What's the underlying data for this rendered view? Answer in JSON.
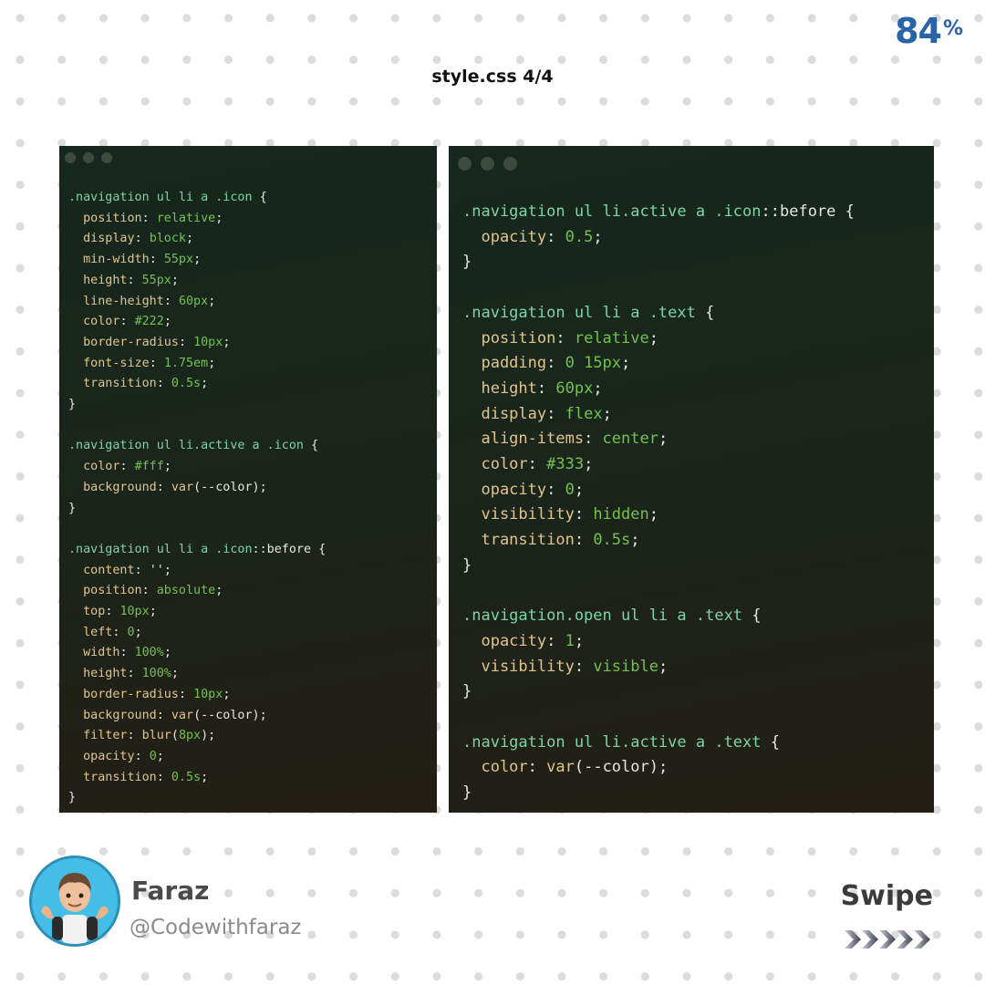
{
  "badge": {
    "number": "84",
    "symbol": "%"
  },
  "file_title": "style.css 4/4",
  "left_window": {
    "lines": [
      [
        [
          ".navigation ul li a .icon",
          "sel"
        ],
        [
          " {",
          "pn"
        ]
      ],
      [
        [
          "  position",
          "prop"
        ],
        [
          ": ",
          "pn"
        ],
        [
          "relative",
          "val"
        ],
        [
          ";",
          "pn"
        ]
      ],
      [
        [
          "  display",
          "prop"
        ],
        [
          ": ",
          "pn"
        ],
        [
          "block",
          "val"
        ],
        [
          ";",
          "pn"
        ]
      ],
      [
        [
          "  min-width",
          "prop"
        ],
        [
          ": ",
          "pn"
        ],
        [
          "55px",
          "val"
        ],
        [
          ";",
          "pn"
        ]
      ],
      [
        [
          "  height",
          "prop"
        ],
        [
          ": ",
          "pn"
        ],
        [
          "55px",
          "val"
        ],
        [
          ";",
          "pn"
        ]
      ],
      [
        [
          "  line-height",
          "prop"
        ],
        [
          ": ",
          "pn"
        ],
        [
          "60px",
          "val"
        ],
        [
          ";",
          "pn"
        ]
      ],
      [
        [
          "  color",
          "prop"
        ],
        [
          ": ",
          "pn"
        ],
        [
          "#222",
          "val"
        ],
        [
          ";",
          "pn"
        ]
      ],
      [
        [
          "  border-radius",
          "prop"
        ],
        [
          ": ",
          "pn"
        ],
        [
          "10px",
          "val"
        ],
        [
          ";",
          "pn"
        ]
      ],
      [
        [
          "  font-size",
          "prop"
        ],
        [
          ": ",
          "pn"
        ],
        [
          "1.75em",
          "val"
        ],
        [
          ";",
          "pn"
        ]
      ],
      [
        [
          "  transition",
          "prop"
        ],
        [
          ": ",
          "pn"
        ],
        [
          "0.5s",
          "val"
        ],
        [
          ";",
          "pn"
        ]
      ],
      [
        [
          "}",
          "pn"
        ]
      ],
      [],
      [
        [
          ".navigation ul li.active a .icon",
          "sel"
        ],
        [
          " {",
          "pn"
        ]
      ],
      [
        [
          "  color",
          "prop"
        ],
        [
          ": ",
          "pn"
        ],
        [
          "#fff",
          "val"
        ],
        [
          ";",
          "pn"
        ]
      ],
      [
        [
          "  background",
          "prop"
        ],
        [
          ": ",
          "pn"
        ],
        [
          "var",
          "fn"
        ],
        [
          "(--color);",
          "pn"
        ]
      ],
      [
        [
          "}",
          "pn"
        ]
      ],
      [],
      [
        [
          ".navigation ul li a .icon",
          "sel"
        ],
        [
          "::before",
          "pn"
        ],
        [
          " {",
          "pn"
        ]
      ],
      [
        [
          "  content",
          "prop"
        ],
        [
          ": ",
          "pn"
        ],
        [
          "''",
          "pn"
        ],
        [
          ";",
          "pn"
        ]
      ],
      [
        [
          "  position",
          "prop"
        ],
        [
          ": ",
          "pn"
        ],
        [
          "absolute",
          "val"
        ],
        [
          ";",
          "pn"
        ]
      ],
      [
        [
          "  top",
          "prop"
        ],
        [
          ": ",
          "pn"
        ],
        [
          "10px",
          "val"
        ],
        [
          ";",
          "pn"
        ]
      ],
      [
        [
          "  left",
          "prop"
        ],
        [
          ": ",
          "pn"
        ],
        [
          "0",
          "val"
        ],
        [
          ";",
          "pn"
        ]
      ],
      [
        [
          "  width",
          "prop"
        ],
        [
          ": ",
          "pn"
        ],
        [
          "100%",
          "val"
        ],
        [
          ";",
          "pn"
        ]
      ],
      [
        [
          "  height",
          "prop"
        ],
        [
          ": ",
          "pn"
        ],
        [
          "100%",
          "val"
        ],
        [
          ";",
          "pn"
        ]
      ],
      [
        [
          "  border-radius",
          "prop"
        ],
        [
          ": ",
          "pn"
        ],
        [
          "10px",
          "val"
        ],
        [
          ";",
          "pn"
        ]
      ],
      [
        [
          "  background",
          "prop"
        ],
        [
          ": ",
          "pn"
        ],
        [
          "var",
          "fn"
        ],
        [
          "(--color);",
          "pn"
        ]
      ],
      [
        [
          "  filter",
          "prop"
        ],
        [
          ": ",
          "pn"
        ],
        [
          "blur",
          "fn"
        ],
        [
          "(",
          "pn"
        ],
        [
          "8px",
          "val"
        ],
        [
          ");",
          "pn"
        ]
      ],
      [
        [
          "  opacity",
          "prop"
        ],
        [
          ": ",
          "pn"
        ],
        [
          "0",
          "val"
        ],
        [
          ";",
          "pn"
        ]
      ],
      [
        [
          "  transition",
          "prop"
        ],
        [
          ": ",
          "pn"
        ],
        [
          "0.5s",
          "val"
        ],
        [
          ";",
          "pn"
        ]
      ],
      [
        [
          "}",
          "pn"
        ]
      ]
    ]
  },
  "right_window": {
    "lines": [
      [
        [
          ".navigation ul li.active a .icon",
          "sel"
        ],
        [
          "::before",
          "pn"
        ],
        [
          " {",
          "pn"
        ]
      ],
      [
        [
          "  opacity",
          "prop"
        ],
        [
          ": ",
          "pn"
        ],
        [
          "0.5",
          "val"
        ],
        [
          ";",
          "pn"
        ]
      ],
      [
        [
          "}",
          "pn"
        ]
      ],
      [],
      [
        [
          ".navigation ul li a .text",
          "sel"
        ],
        [
          " {",
          "pn"
        ]
      ],
      [
        [
          "  position",
          "prop"
        ],
        [
          ": ",
          "pn"
        ],
        [
          "relative",
          "val"
        ],
        [
          ";",
          "pn"
        ]
      ],
      [
        [
          "  padding",
          "prop"
        ],
        [
          ": ",
          "pn"
        ],
        [
          "0 15px",
          "val"
        ],
        [
          ";",
          "pn"
        ]
      ],
      [
        [
          "  height",
          "prop"
        ],
        [
          ": ",
          "pn"
        ],
        [
          "60px",
          "val"
        ],
        [
          ";",
          "pn"
        ]
      ],
      [
        [
          "  display",
          "prop"
        ],
        [
          ": ",
          "pn"
        ],
        [
          "flex",
          "val"
        ],
        [
          ";",
          "pn"
        ]
      ],
      [
        [
          "  align-items",
          "prop"
        ],
        [
          ": ",
          "pn"
        ],
        [
          "center",
          "val"
        ],
        [
          ";",
          "pn"
        ]
      ],
      [
        [
          "  color",
          "prop"
        ],
        [
          ": ",
          "pn"
        ],
        [
          "#333",
          "val"
        ],
        [
          ";",
          "pn"
        ]
      ],
      [
        [
          "  opacity",
          "prop"
        ],
        [
          ": ",
          "pn"
        ],
        [
          "0",
          "val"
        ],
        [
          ";",
          "pn"
        ]
      ],
      [
        [
          "  visibility",
          "prop"
        ],
        [
          ": ",
          "pn"
        ],
        [
          "hidden",
          "val"
        ],
        [
          ";",
          "pn"
        ]
      ],
      [
        [
          "  transition",
          "prop"
        ],
        [
          ": ",
          "pn"
        ],
        [
          "0.5s",
          "val"
        ],
        [
          ";",
          "pn"
        ]
      ],
      [
        [
          "}",
          "pn"
        ]
      ],
      [],
      [
        [
          ".navigation.open ul li a .text",
          "sel"
        ],
        [
          " {",
          "pn"
        ]
      ],
      [
        [
          "  opacity",
          "prop"
        ],
        [
          ": ",
          "pn"
        ],
        [
          "1",
          "val"
        ],
        [
          ";",
          "pn"
        ]
      ],
      [
        [
          "  visibility",
          "prop"
        ],
        [
          ": ",
          "pn"
        ],
        [
          "visible",
          "val"
        ],
        [
          ";",
          "pn"
        ]
      ],
      [
        [
          "}",
          "pn"
        ]
      ],
      [],
      [
        [
          ".navigation ul li.active a .text",
          "sel"
        ],
        [
          " {",
          "pn"
        ]
      ],
      [
        [
          "  color",
          "prop"
        ],
        [
          ": ",
          "pn"
        ],
        [
          "var",
          "fn"
        ],
        [
          "(--color);",
          "pn"
        ]
      ],
      [
        [
          "}",
          "pn"
        ]
      ]
    ]
  },
  "author": {
    "name": "Faraz",
    "handle": "@Codewithfaraz"
  },
  "swipe": {
    "label": "Swipe"
  },
  "colors": {
    "badge_blue": "#2b63a8",
    "selector": "#7ed3a6",
    "property": "#e2c58c",
    "value": "#74c24e",
    "punctuation": "#e6e6e6",
    "editor_bg": "#1a251b"
  },
  "icons": [
    "window-dot-icon",
    "avatar-memoji-icon",
    "swipe-arrows-icon"
  ]
}
